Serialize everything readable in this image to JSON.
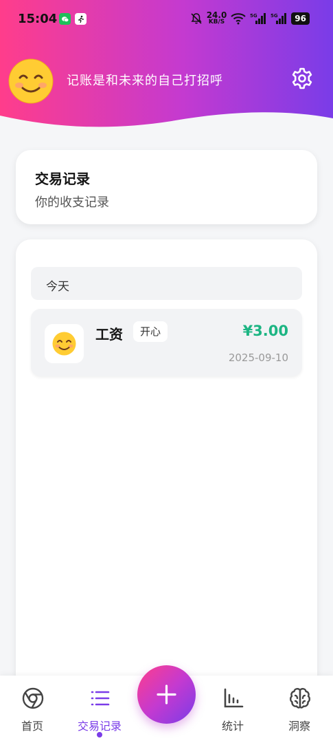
{
  "status_bar": {
    "time": "15:04",
    "net_speed_value": "24.0",
    "net_speed_unit": "KB/S",
    "signal_1": "5G",
    "signal_2": "5G",
    "battery": "96"
  },
  "header": {
    "slogan": "记账是和未来的自己打招呼",
    "avatar_icon": "smiling-face-emoji",
    "settings_icon": "gear-icon"
  },
  "title_card": {
    "title": "交易记录",
    "subtitle": "你的收支记录"
  },
  "transactions": {
    "groups": [
      {
        "label": "今天",
        "items": [
          {
            "name": "工资",
            "tag": "开心",
            "amount": "¥3.00",
            "date": "2025-09-10",
            "icon": "smiling-face-emoji"
          }
        ]
      }
    ]
  },
  "bottom_nav": {
    "items": [
      {
        "label": "首页",
        "icon": "chrome-circle-icon"
      },
      {
        "label": "交易记录",
        "icon": "list-icon",
        "active": true
      },
      {
        "label": "统计",
        "icon": "bar-chart-icon"
      },
      {
        "label": "洞察",
        "icon": "brain-icon"
      }
    ],
    "fab_icon": "plus-icon"
  },
  "colors": {
    "gradient_start": "#ff3d8b",
    "gradient_mid": "#c43ad0",
    "gradient_end": "#7a3ce8",
    "income_green": "#1db583",
    "active_purple": "#7a3ce8"
  }
}
